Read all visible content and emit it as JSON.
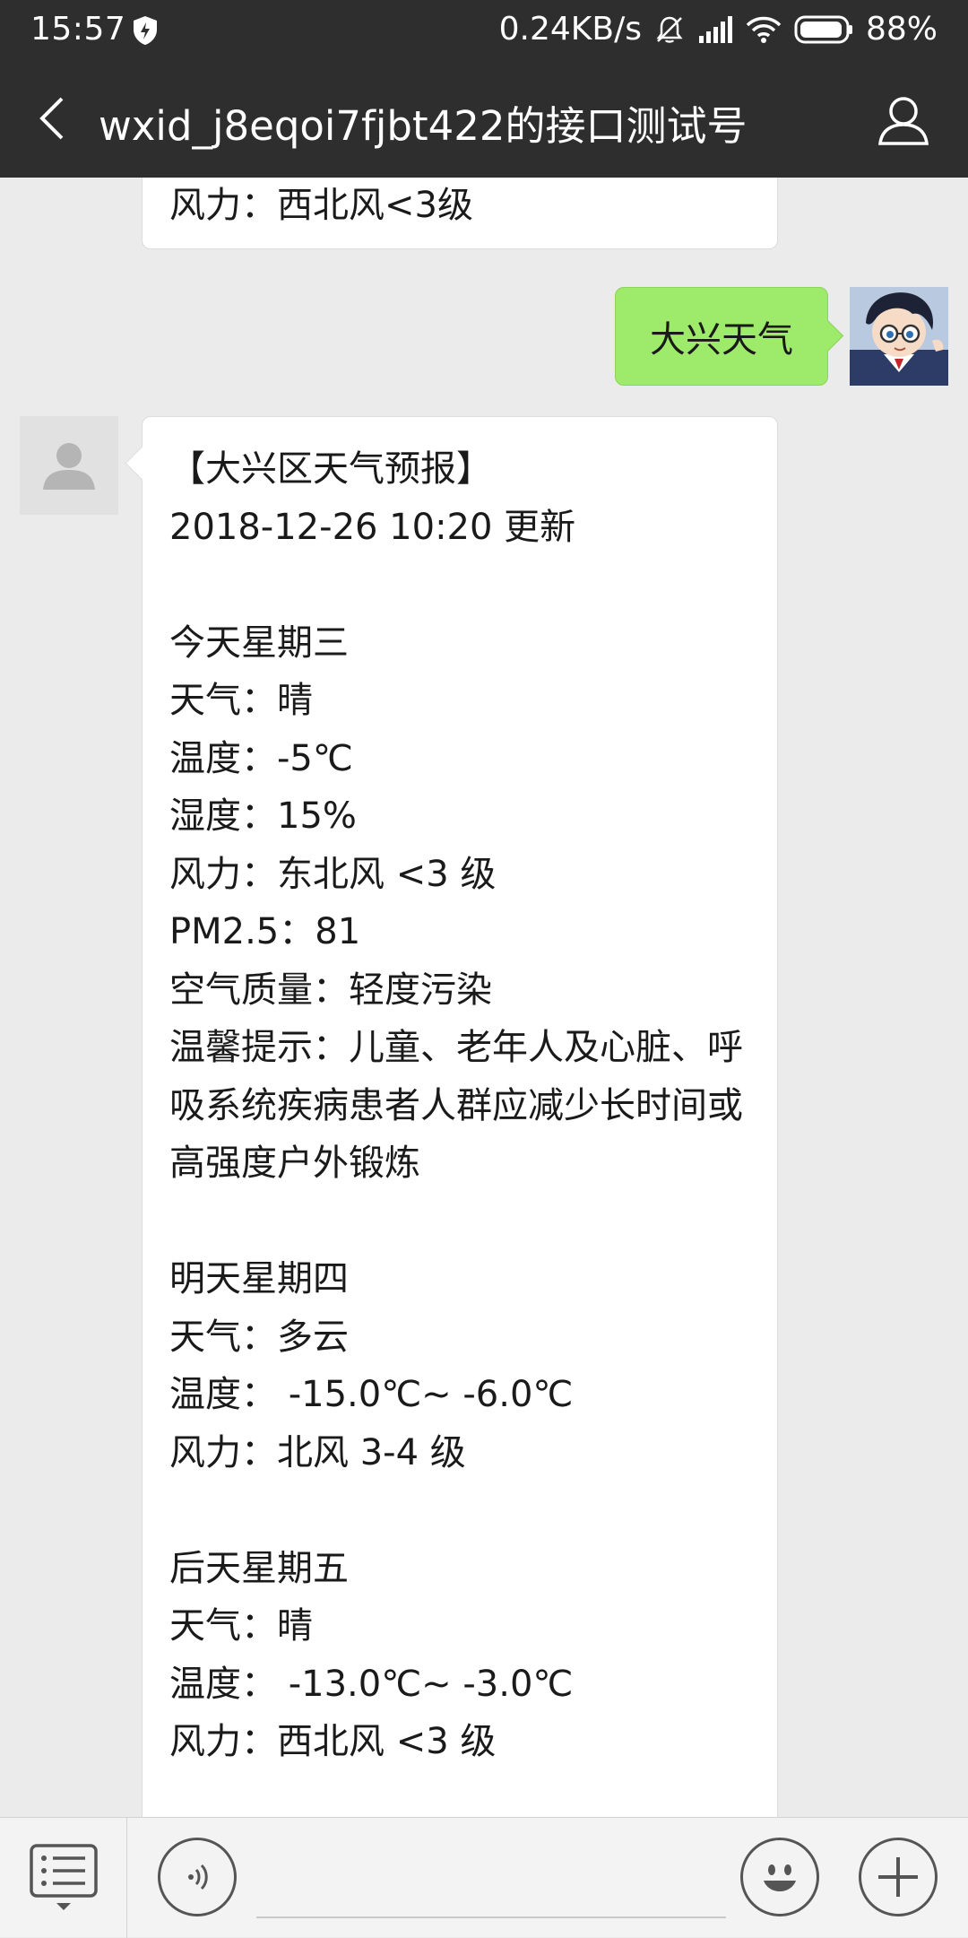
{
  "status_bar": {
    "time": "15:57",
    "net_speed": "0.24KB/s",
    "battery": "88%",
    "icons": [
      "shield-icon",
      "mute-icon",
      "signal-icon",
      "wifi-icon",
      "battery-icon"
    ]
  },
  "header": {
    "title": "wxid_j8eqoi7fjbt422的接口测试号",
    "back_icon": "chevron-left-icon",
    "profile_icon": "person-icon",
    "background": "#2e2e2e"
  },
  "messages": {
    "previous_tail": "风力：西北风<3级",
    "user_message": "大兴天气",
    "forecast_lines": [
      "【大兴区天气预报】",
      "2018-12-26 10:20 更新",
      "",
      "今天星期三",
      "天气：晴",
      "温度：-5℃",
      "湿度：15%",
      "风力：东北风 <3 级",
      "PM2.5：81",
      "空气质量：轻度污染",
      "温馨提示：儿童、老年人及心脏、呼吸系统疾病患者人群应减少长时间或高强度户外锻炼",
      "",
      "明天星期四",
      "天气：多云",
      "温度： -15.0℃~ -6.0℃",
      "风力：北风 3-4 级",
      "",
      "后天星期五",
      "天气：晴",
      "温度： -13.0℃~ -3.0℃",
      "风力：西北风 <3 级"
    ]
  },
  "input_bar": {
    "menu_icon": "list-menu-icon",
    "voice_icon": "voice-icon",
    "input_value": "",
    "emoji_icon": "smiley-icon",
    "plus_icon": "plus-icon"
  },
  "colors": {
    "user_bubble": "#9eea6a",
    "bot_bubble": "#ffffff",
    "chat_background": "#ebebeb"
  }
}
